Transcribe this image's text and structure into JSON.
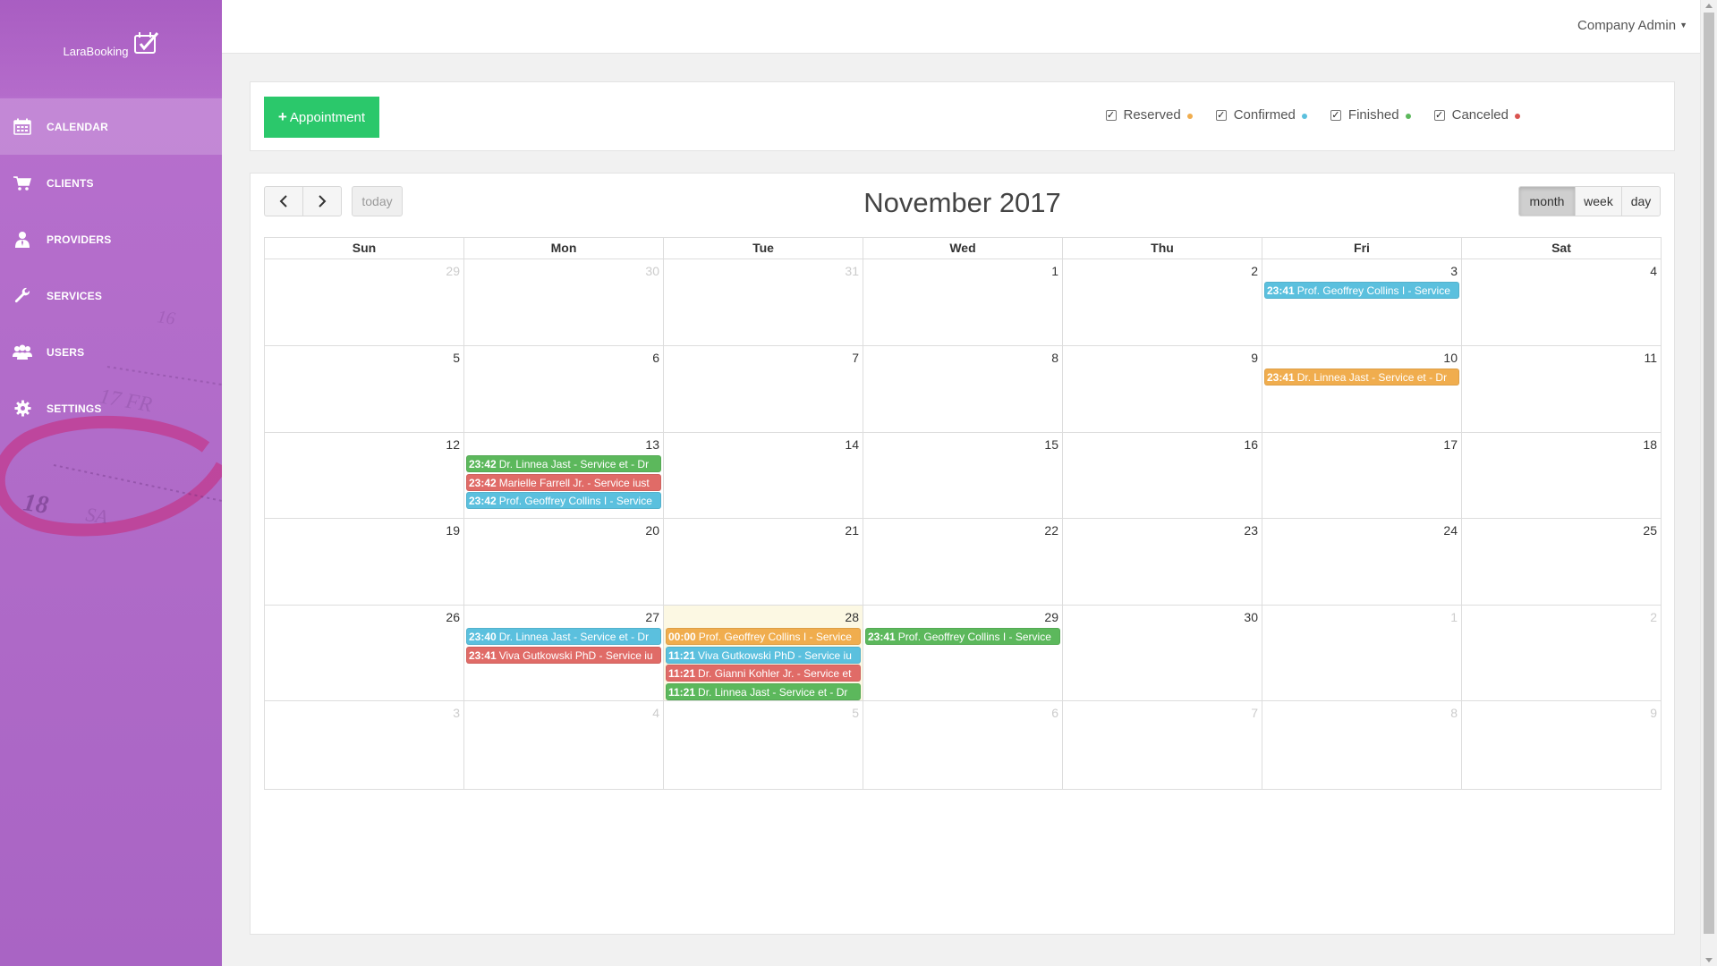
{
  "app": {
    "name": "LaraBooking"
  },
  "sidebar": {
    "items": [
      {
        "label": "CALENDAR",
        "icon": "calendar-icon",
        "active": true
      },
      {
        "label": "CLIENTS",
        "icon": "cart-icon"
      },
      {
        "label": "PROVIDERS",
        "icon": "user-tie-icon"
      },
      {
        "label": "SERVICES",
        "icon": "wrench-icon"
      },
      {
        "label": "USERS",
        "icon": "users-icon"
      },
      {
        "label": "SETTINGS",
        "icon": "gear-icon"
      }
    ]
  },
  "header": {
    "user_menu": "Company Admin"
  },
  "toolbar": {
    "add_label": "Appointment",
    "filters": [
      {
        "label": "Reserved",
        "checked": true,
        "color": "#f0ad4e"
      },
      {
        "label": "Confirmed",
        "checked": true,
        "color": "#5bc0de"
      },
      {
        "label": "Finished",
        "checked": true,
        "color": "#5cb85c"
      },
      {
        "label": "Canceled",
        "checked": true,
        "color": "#d9534f"
      }
    ]
  },
  "calendar": {
    "title": "November 2017",
    "today_label": "today",
    "views": [
      {
        "label": "month",
        "active": true
      },
      {
        "label": "week"
      },
      {
        "label": "day"
      }
    ],
    "days_of_week": [
      "Sun",
      "Mon",
      "Tue",
      "Wed",
      "Thu",
      "Fri",
      "Sat"
    ],
    "status_colors": {
      "reserved": "#f0ad4e",
      "confirmed": "#5bc0de",
      "finished": "#5cb85c",
      "canceled": "#e06b67"
    },
    "weeks": [
      {
        "days": [
          {
            "num": "29",
            "other": true
          },
          {
            "num": "30",
            "other": true
          },
          {
            "num": "31",
            "other": true
          },
          {
            "num": "1"
          },
          {
            "num": "2"
          },
          {
            "num": "3",
            "events": [
              {
                "time": "23:41",
                "title": "Prof. Geoffrey Collins I - Service",
                "status": "confirmed"
              }
            ]
          },
          {
            "num": "4"
          }
        ]
      },
      {
        "days": [
          {
            "num": "5"
          },
          {
            "num": "6"
          },
          {
            "num": "7"
          },
          {
            "num": "8"
          },
          {
            "num": "9"
          },
          {
            "num": "10",
            "events": [
              {
                "time": "23:41",
                "title": "Dr. Linnea Jast - Service et - Dr",
                "status": "reserved"
              }
            ]
          },
          {
            "num": "11"
          }
        ]
      },
      {
        "days": [
          {
            "num": "12"
          },
          {
            "num": "13",
            "events": [
              {
                "time": "23:42",
                "title": "Dr. Linnea Jast - Service et - Dr",
                "status": "finished"
              },
              {
                "time": "23:42",
                "title": "Marielle Farrell Jr. - Service iust",
                "status": "canceled"
              },
              {
                "time": "23:42",
                "title": "Prof. Geoffrey Collins I - Service",
                "status": "confirmed"
              }
            ]
          },
          {
            "num": "14"
          },
          {
            "num": "15"
          },
          {
            "num": "16"
          },
          {
            "num": "17"
          },
          {
            "num": "18"
          }
        ]
      },
      {
        "days": [
          {
            "num": "19"
          },
          {
            "num": "20"
          },
          {
            "num": "21"
          },
          {
            "num": "22"
          },
          {
            "num": "23"
          },
          {
            "num": "24"
          },
          {
            "num": "25"
          }
        ]
      },
      {
        "days": [
          {
            "num": "26"
          },
          {
            "num": "27",
            "events": [
              {
                "time": "23:40",
                "title": "Dr. Linnea Jast - Service et - Dr",
                "status": "confirmed"
              },
              {
                "time": "23:41",
                "title": "Viva Gutkowski PhD - Service iu",
                "status": "canceled"
              }
            ]
          },
          {
            "num": "28",
            "today": true,
            "events": [
              {
                "time": "00:00",
                "title": "Prof. Geoffrey Collins I - Service",
                "status": "reserved"
              },
              {
                "time": "11:21",
                "title": "Viva Gutkowski PhD - Service iu",
                "status": "confirmed"
              },
              {
                "time": "11:21",
                "title": "Dr. Gianni Kohler Jr. - Service et",
                "status": "canceled"
              },
              {
                "time": "11:21",
                "title": "Dr. Linnea Jast - Service et - Dr",
                "status": "finished"
              }
            ]
          },
          {
            "num": "29",
            "events": [
              {
                "time": "23:41",
                "title": "Prof. Geoffrey Collins I - Service",
                "status": "finished"
              }
            ]
          },
          {
            "num": "30"
          },
          {
            "num": "1",
            "other": true
          },
          {
            "num": "2",
            "other": true
          }
        ]
      },
      {
        "days": [
          {
            "num": "3",
            "other": true
          },
          {
            "num": "4",
            "other": true
          },
          {
            "num": "5",
            "other": true
          },
          {
            "num": "6",
            "other": true
          },
          {
            "num": "7",
            "other": true
          },
          {
            "num": "8",
            "other": true
          },
          {
            "num": "9",
            "other": true
          }
        ]
      }
    ]
  }
}
